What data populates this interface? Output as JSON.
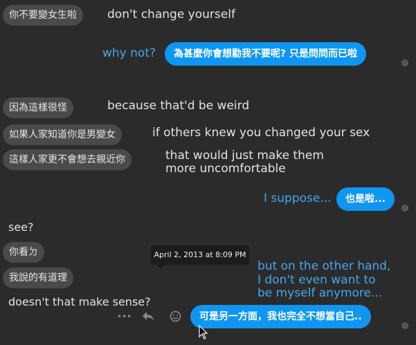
{
  "messages": [
    {
      "chinese": "你不要變女生啦",
      "translation": "don't change yourself"
    },
    {
      "chinese": "為甚麼你會想勸我不要呢? 只是問問而已啦",
      "translation": "why not?"
    },
    {
      "chinese": "因為這樣很怪",
      "translation": "because that'd be weird"
    },
    {
      "chinese": "如果人家知道你是男變女",
      "translation": "if others knew you changed your sex"
    },
    {
      "chinese": "這樣人家更不會想去親近你",
      "translation_line1": "that would just make them",
      "translation_line2": "more uncomfortable"
    },
    {
      "chinese": "也是啦...",
      "translation": "I suppose..."
    },
    {
      "plain": "see?"
    },
    {
      "chinese": "你看ㄉ"
    },
    {
      "chinese": "我說的有道理"
    },
    {
      "plain": "doesn't that make sense?"
    },
    {
      "chinese": "可是另一方面，我也完全不想當自己..",
      "translation_line1": "but on the other hand,",
      "translation_line2": "I don't even want to",
      "translation_line3": "be myself anymore..."
    }
  ],
  "tooltip": "April 2, 2013 at 8:09 PM",
  "actions": {
    "more": "•••",
    "reply": "reply-icon",
    "emoji": "emoji-icon"
  },
  "colors": {
    "background": "#2b2b2b",
    "incoming": "#4a4a4a",
    "outgoing": "#0f96f0",
    "translation_outgoing": "#46a8ee"
  }
}
